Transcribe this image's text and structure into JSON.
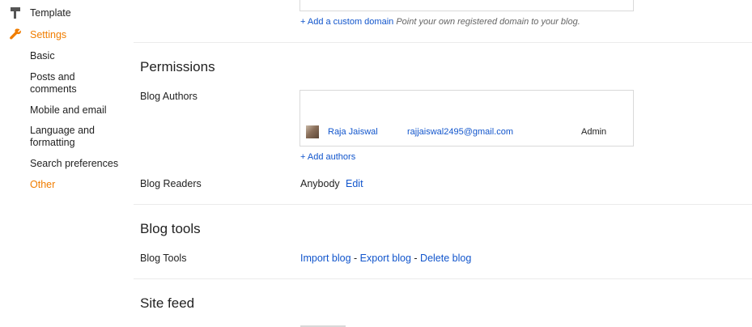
{
  "sidebar": {
    "template": "Template",
    "settings": "Settings",
    "basic": "Basic",
    "posts_comments_1": "Posts and",
    "posts_comments_2": "comments",
    "mobile_email": "Mobile and email",
    "language_1": "Language and",
    "language_2": "formatting",
    "search_prefs": "Search preferences",
    "other": "Other"
  },
  "domain": {
    "add_link": "+ Add a custom domain",
    "helper": "Point your own registered domain to your blog."
  },
  "permissions": {
    "title": "Permissions",
    "authors_label": "Blog Authors",
    "author": {
      "name": "Raja Jaiswal",
      "email": "rajjaiswal2495@gmail.com",
      "role": "Admin"
    },
    "add_authors": "+ Add authors",
    "readers_label": "Blog Readers",
    "readers_value": "Anybody",
    "readers_edit": "Edit"
  },
  "blog_tools": {
    "title": "Blog tools",
    "label": "Blog Tools",
    "import": "Import blog",
    "export": "Export blog",
    "delete": "Delete blog",
    "sep": "-"
  },
  "site_feed": {
    "title": "Site feed"
  },
  "colors": {
    "accent_orange": "#f07d00",
    "settings_red": "#dd4b39",
    "link_blue": "#1155cc"
  }
}
